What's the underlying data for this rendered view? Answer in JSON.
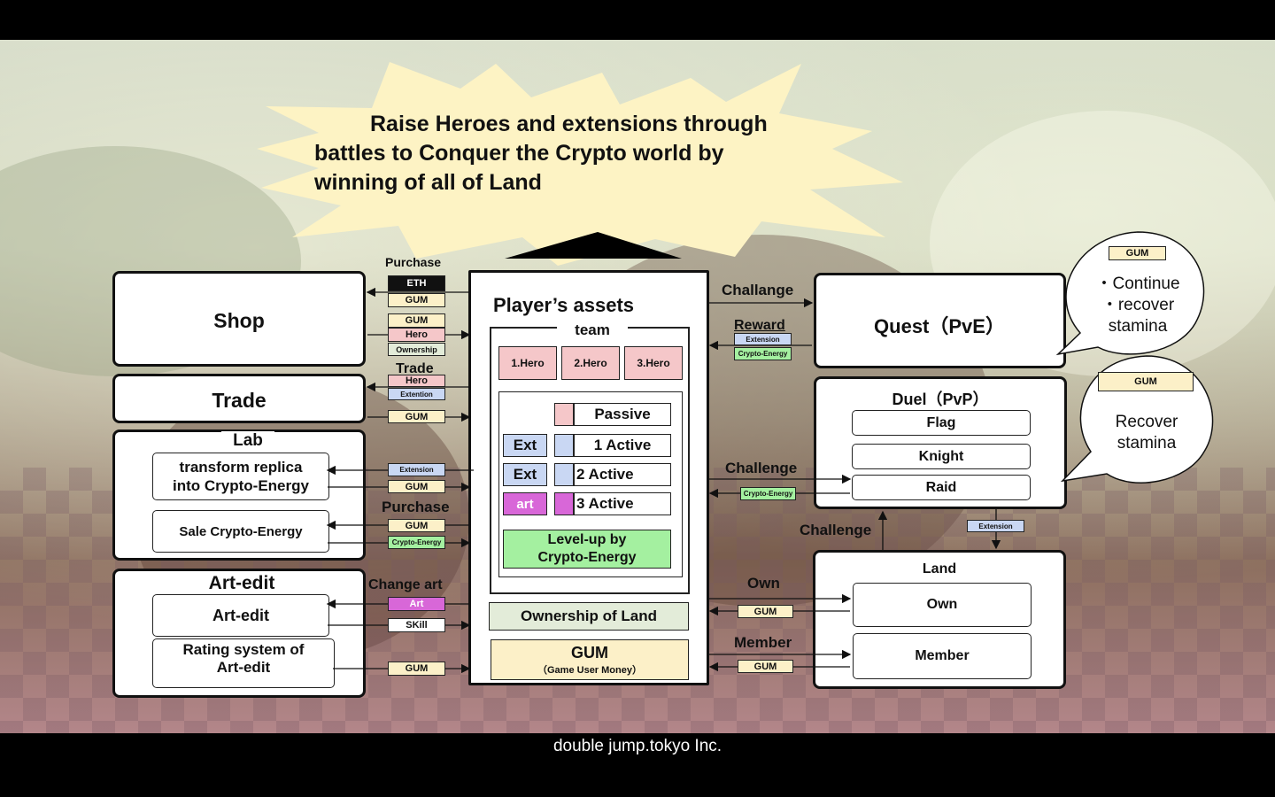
{
  "banner": {
    "line1": "Raise Heroes and extensions through",
    "line2": "battles to Conquer the Crypto world by",
    "line3": "winning of all of Land"
  },
  "left": {
    "shop": "Shop",
    "trade": "Trade",
    "lab": "Lab",
    "lab_transform_1": "transform replica",
    "lab_transform_2": "into Crypto-Energy",
    "lab_sale": "Sale Crypto-Energy",
    "artedit_title": "Art-edit",
    "artedit_item": "Art-edit",
    "rating_1": "Rating system of",
    "rating_2": "Art-edit"
  },
  "labels": {
    "purchase": "Purchase",
    "trade": "Trade",
    "purchase2": "Purchase",
    "change_art": "Change art",
    "challange": "Challange",
    "reward": "Reward",
    "challenge": "Challenge",
    "challenge2": "Challenge",
    "own": "Own",
    "member": "Member"
  },
  "tags": {
    "eth": "ETH",
    "gum": "GUM",
    "hero": "Hero",
    "ownership": "Ownership",
    "extention": "Extention",
    "extension": "Extension",
    "crypto_energy": "Crypto-Energy",
    "art": "Art",
    "skill": "SKill"
  },
  "center": {
    "title": "Player’s assets",
    "team": "team",
    "hero1": "1.Hero",
    "hero2": "2.Hero",
    "hero3": "3.Hero",
    "passive": "Passive",
    "ext": "Ext",
    "art": "art",
    "active1": "1 Active",
    "active2": "2 Active",
    "active3": "3 Active",
    "levelup_1": "Level-up by",
    "levelup_2": "Crypto-Energy",
    "ownership_land": "Ownership of Land",
    "gum": "GUM",
    "gum_sub": "（Game User Money）"
  },
  "right": {
    "quest": "Quest（PvE）",
    "duel": "Duel（PvP）",
    "flag": "Flag",
    "knight": "Knight",
    "raid": "Raid",
    "land": "Land",
    "own": "Own",
    "member": "Member"
  },
  "bubbles": {
    "quest_gum": "GUM",
    "quest_line1": "・Continue",
    "quest_line2": "・recover",
    "quest_line3": "stamina",
    "duel_gum": "GUM",
    "duel_line1": "Recover",
    "duel_line2": "stamina"
  },
  "footer": "double jump.tokyo Inc.",
  "colors": {
    "gum": "#fcf0c8",
    "hero": "#f5c7c9",
    "extension": "#c9d7f3",
    "crypto_energy": "#a4f0a0",
    "art": "#d867d8",
    "ownership_land": "#e3ecd9"
  }
}
